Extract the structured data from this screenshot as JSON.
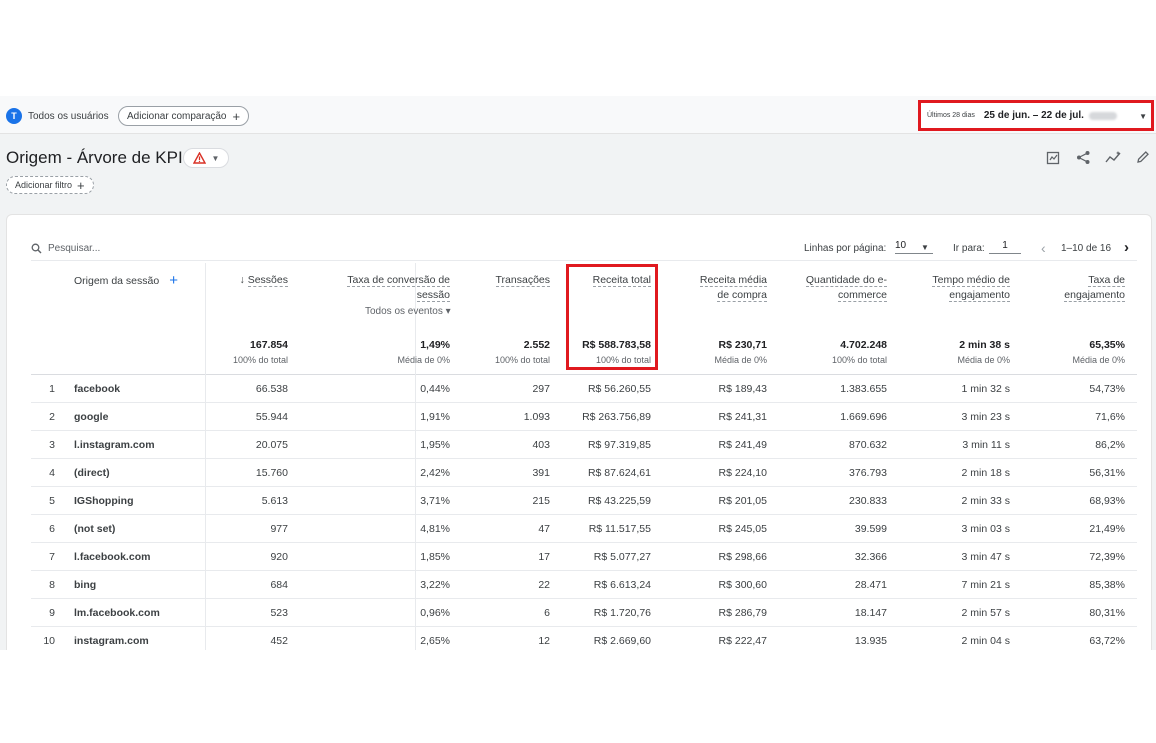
{
  "topbar": {
    "avatar_letter": "T",
    "user_segment": "Todos os usuários",
    "compare_button": "Adicionar comparação",
    "date_label": "Últimos 28 dias",
    "date_range": "25 de jun. – 22 de jul."
  },
  "report": {
    "title": "Origem - Árvore de KPI",
    "add_filter": "Adicionar filtro"
  },
  "toolbar": {
    "search_placeholder": "Pesquisar...",
    "rows_per_page_label": "Linhas por página:",
    "rows_per_page_value": "10",
    "goto_label": "Ir para:",
    "goto_value": "1",
    "page_range": "1–10 de 16"
  },
  "table": {
    "dimension_header": "Origem da sessão",
    "columns": [
      {
        "label": "Sessões",
        "total": "167.854",
        "pct": "100% do total"
      },
      {
        "label": "Taxa de conversão de sessão",
        "sub": "Todos os eventos",
        "total": "1,49%",
        "pct": "Média de 0%"
      },
      {
        "label": "Transações",
        "total": "2.552",
        "pct": "100% do total"
      },
      {
        "label": "Receita total",
        "total": "R$ 588.783,58",
        "pct": "100% do total"
      },
      {
        "label": "Receita média de compra",
        "total": "R$ 230,71",
        "pct": "Média de 0%"
      },
      {
        "label": "Quantidade do e-commerce",
        "total": "4.702.248",
        "pct": "100% do total"
      },
      {
        "label": "Tempo médio de engajamento",
        "total": "2 min 38 s",
        "pct": "Média de 0%"
      },
      {
        "label": "Taxa de engajamento",
        "total": "65,35%",
        "pct": "Média de 0%"
      }
    ],
    "rows": [
      {
        "idx": "1",
        "src": "facebook",
        "v": [
          "66.538",
          "0,44%",
          "297",
          "R$ 56.260,55",
          "R$ 189,43",
          "1.383.655",
          "1 min 32 s",
          "54,73%"
        ]
      },
      {
        "idx": "2",
        "src": "google",
        "v": [
          "55.944",
          "1,91%",
          "1.093",
          "R$ 263.756,89",
          "R$ 241,31",
          "1.669.696",
          "3 min 23 s",
          "71,6%"
        ]
      },
      {
        "idx": "3",
        "src": "l.instagram.com",
        "v": [
          "20.075",
          "1,95%",
          "403",
          "R$ 97.319,85",
          "R$ 241,49",
          "870.632",
          "3 min 11 s",
          "86,2%"
        ]
      },
      {
        "idx": "4",
        "src": "(direct)",
        "v": [
          "15.760",
          "2,42%",
          "391",
          "R$ 87.624,61",
          "R$ 224,10",
          "376.793",
          "2 min 18 s",
          "56,31%"
        ]
      },
      {
        "idx": "5",
        "src": "IGShopping",
        "v": [
          "5.613",
          "3,71%",
          "215",
          "R$ 43.225,59",
          "R$ 201,05",
          "230.833",
          "2 min 33 s",
          "68,93%"
        ]
      },
      {
        "idx": "6",
        "src": "(not set)",
        "v": [
          "977",
          "4,81%",
          "47",
          "R$ 11.517,55",
          "R$ 245,05",
          "39.599",
          "3 min 03 s",
          "21,49%"
        ]
      },
      {
        "idx": "7",
        "src": "l.facebook.com",
        "v": [
          "920",
          "1,85%",
          "17",
          "R$ 5.077,27",
          "R$ 298,66",
          "32.366",
          "3 min 47 s",
          "72,39%"
        ]
      },
      {
        "idx": "8",
        "src": "bing",
        "v": [
          "684",
          "3,22%",
          "22",
          "R$ 6.613,24",
          "R$ 300,60",
          "28.471",
          "7 min 21 s",
          "85,38%"
        ]
      },
      {
        "idx": "9",
        "src": "lm.facebook.com",
        "v": [
          "523",
          "0,96%",
          "6",
          "R$ 1.720,76",
          "R$ 286,79",
          "18.147",
          "2 min 57 s",
          "80,31%"
        ]
      },
      {
        "idx": "10",
        "src": "instagram.com",
        "v": [
          "452",
          "2,65%",
          "12",
          "R$ 2.669,60",
          "R$ 222,47",
          "13.935",
          "2 min 04 s",
          "63,72%"
        ]
      }
    ]
  },
  "colors": {
    "accent": "#1a73e8",
    "highlight": "#e0191f",
    "warning": "#d93025"
  }
}
